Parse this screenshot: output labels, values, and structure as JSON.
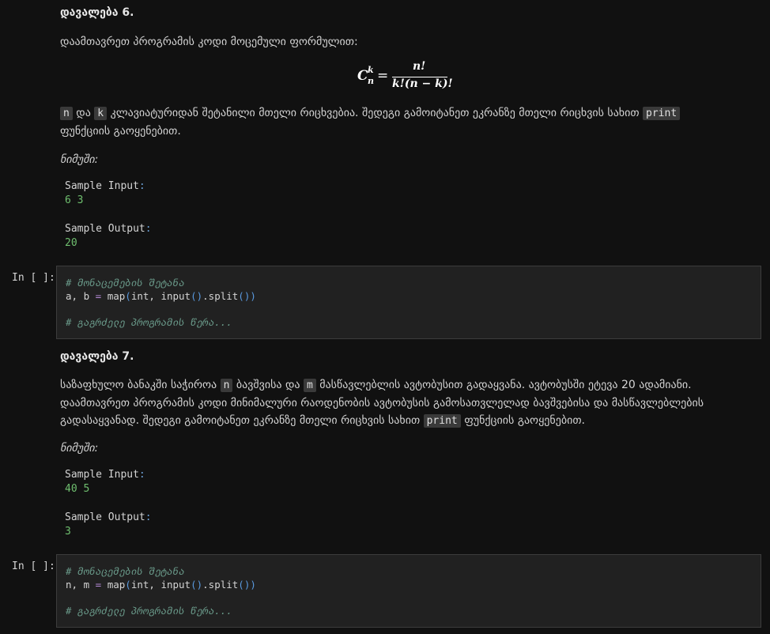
{
  "task6": {
    "title": "დავალება 6.",
    "intro": "დაამთავრეთ პროგრამის კოდი მოცემული ფორმულით:",
    "formula": {
      "lhs_base": "C",
      "lhs_sup": "k",
      "lhs_sub": "n",
      "eq": "=",
      "numerator": "n!",
      "denominator": "k!(n − k)!"
    },
    "desc_var1": "n",
    "desc_and": " და ",
    "desc_var2": "k",
    "desc_part1": " კლავიატურიდან შეტანილი მთელი რიცხვებია. შედეგი გამოიტანეთ ეკრანზე მთელი რიცხვის სახით ",
    "desc_code": "print",
    "desc_part2": "ფუნქციის გაოყენებით.",
    "example_label": "ნიმუში:",
    "sample_input_label": "Sample Input",
    "sample_input_value": "6 3",
    "sample_output_label": "Sample Output",
    "sample_output_value": "20"
  },
  "cell1": {
    "prompt": "In [ ]:",
    "comment1": "# მონაცემების შეტანა",
    "line_vars": "a, b",
    "line_eq": "=",
    "line_fn": "map",
    "line_args": "int, input",
    "line_tail": ".split",
    "comment2": "# გაგრძელე პროგრამის წერა..."
  },
  "task7": {
    "title": "დავალება 7.",
    "line1_a": "საზაფხულო ბანაკში საჭიროა ",
    "var_n": "n",
    "line1_b": " ბავშვისა და ",
    "var_m": "m",
    "line1_c": " მასწავლებლის ავტობუსით გადაყვანა. ავტობუსში ეტევა 20 ადამიანი.",
    "line2": "დაამთავრეთ პროგრამის კოდი მინიმალური რაოდენობის ავტობუსის გამოსათვლელად ბავშვებისა და მასწავლებლების",
    "line3_a": "გადასაყვანად. შედეგი გამოიტანეთ ეკრანზე მთელი რიცხვის სახით ",
    "line3_code": "print",
    "line3_b": " ფუნქციის გაოყენებით.",
    "example_label": "ნიმუში:",
    "sample_input_label": "Sample Input",
    "sample_input_value": "40 5",
    "sample_output_label": "Sample Output",
    "sample_output_value": "3"
  },
  "cell2": {
    "prompt": "In [ ]:",
    "comment1": "# მონაცემების შეტანა",
    "line_vars": "n, m",
    "line_eq": "=",
    "line_fn": "map",
    "line_args": "int, input",
    "line_tail": ".split",
    "comment2": "# გაგრძელე პროგრამის წერა..."
  }
}
